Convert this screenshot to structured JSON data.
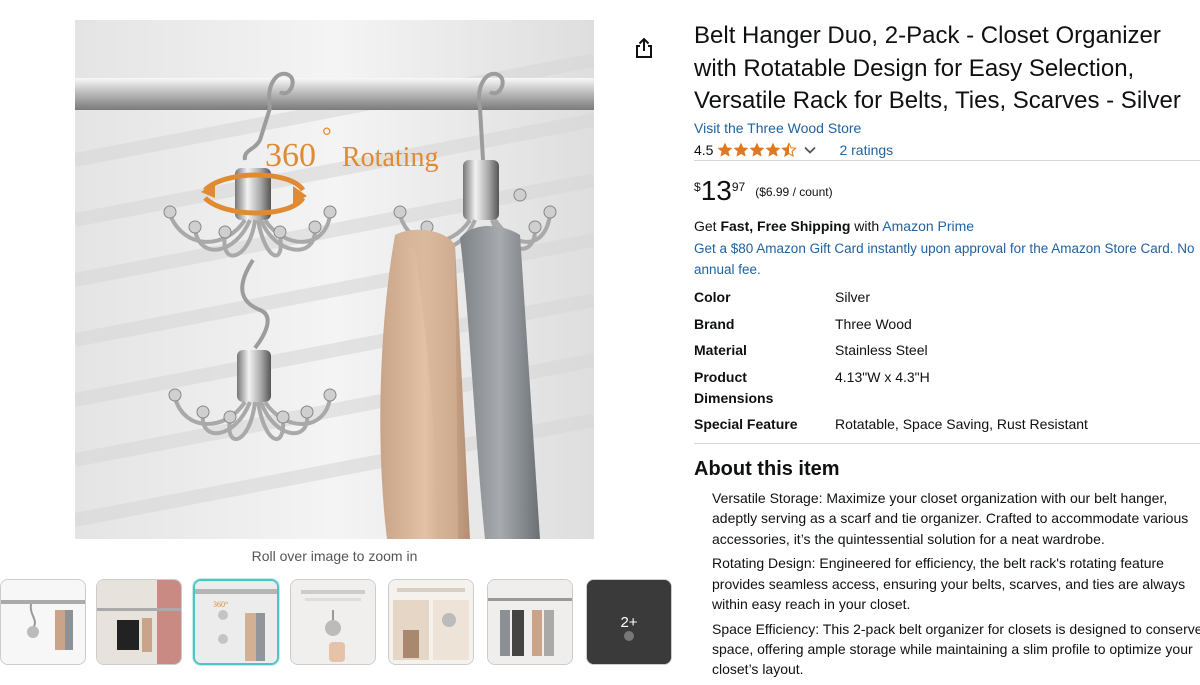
{
  "product": {
    "title": "Belt Hanger Duo, 2-Pack - Closet Organizer with Rotatable Design for Easy Selection, Versatile Rack for Belts, Ties, Scarves - Silver",
    "title_lines": [
      "Belt Hanger Duo, 2-Pack - Closet Organizer",
      "with Rotatable Design for Easy Selection,",
      "Versatile Rack for Belts, Ties, Scarves - Silver"
    ],
    "store_link": "Visit the Three Wood Store",
    "rating": "4.5",
    "rating_stars": 4.5,
    "rating_count": "2 ratings",
    "price_symbol": "$",
    "price_whole": "13",
    "price_fraction": "97",
    "unit_price": "($6.99 / count)",
    "shipping_prefix": "Get ",
    "shipping_bold": "Fast, Free Shipping",
    "shipping_mid": " with ",
    "shipping_link": "Amazon Prime",
    "gift_card": "Get a $80 Amazon Gift Card instantly upon approval for the Amazon Store Card. No annual fee.",
    "gift_card_lines": [
      "Get a $80 Amazon Gift Card instantly upon approval for the Amazon Store Card. No",
      "annual fee."
    ]
  },
  "image": {
    "overlay_number": "360",
    "overlay_degree": "°",
    "overlay_text": "Rotating",
    "zoom_hint": "Roll over image to zoom in",
    "thumbnail_more": "2+",
    "thumbnail_count": 7,
    "selected_thumbnail": 3
  },
  "specs": [
    {
      "label": "Color",
      "value": "Silver"
    },
    {
      "label": "Brand",
      "value": "Three Wood"
    },
    {
      "label": "Material",
      "value": "Stainless Steel"
    },
    {
      "label": "Product Dimensions",
      "label_lines": [
        "Product",
        "Dimensions"
      ],
      "value": "4.13\"W x 4.3\"H"
    },
    {
      "label": "Special Feature",
      "value": "Rotatable, Space Saving, Rust Resistant"
    }
  ],
  "about": {
    "title": "About this item",
    "bullets": [
      {
        "lines": [
          "Versatile Storage: Maximize your closet organization with our belt hanger,",
          "adeptly serving as a scarf and tie organizer. Crafted to accommodate various",
          "accessories, it’s the quintessential solution for a neat wardrobe."
        ]
      },
      {
        "lines": [
          "Rotating Design: Engineered for efficiency, the belt rack's rotating feature",
          "provides seamless access, ensuring your belts, scarves, and ties are always",
          "within easy reach in your closet."
        ]
      },
      {
        "lines": [
          "Space Efficiency: This 2-pack belt organizer for closets is designed to conserve",
          "space, offering ample storage while maintaining a slim profile to optimize your",
          "closet’s layout."
        ]
      }
    ]
  },
  "colors": {
    "link": "#2162a1",
    "star": "#de7921",
    "text": "#0f1111",
    "selected_thumb_border": "#4fc4c7"
  },
  "icons": {
    "share": "share-icon",
    "star": "star-icon",
    "chevron": "chevron-down-icon"
  }
}
